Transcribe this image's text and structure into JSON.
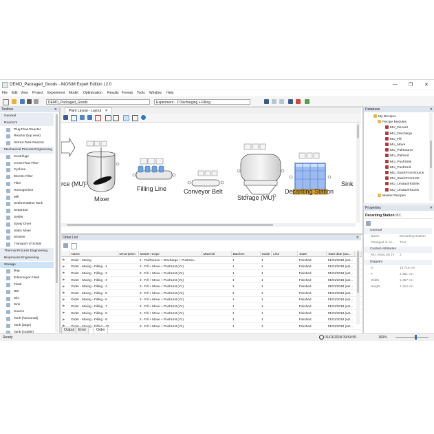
{
  "window": {
    "title": "DEMO_Packaged_Goods - INOSIM Expert Edition 12.0",
    "controls": [
      "—",
      "❐",
      "✕"
    ]
  },
  "menu": [
    "File",
    "Edit",
    "View",
    "Project",
    "Experiment",
    "Model",
    "Optimization",
    "Results",
    "Format",
    "Tools",
    "Window",
    "Help"
  ],
  "toolbar": {
    "project_combo": "DEMO_Packaged_Goods",
    "experiment_combo": "Experiment - 2 Discharging + Filling"
  },
  "toolbox": {
    "title": "Toolbox",
    "items": [
      {
        "label": "General",
        "type": "cat"
      },
      {
        "label": "Reactors",
        "type": "cat"
      },
      {
        "label": "Plug Flow Reactor",
        "type": "item"
      },
      {
        "label": "Reactor (top view)",
        "type": "item"
      },
      {
        "label": "Stirred-Tank Reactor",
        "type": "item"
      },
      {
        "label": "Mechanical Process Engineering",
        "type": "cat"
      },
      {
        "label": "Centrifuge",
        "type": "item"
      },
      {
        "label": "Cross Flow Filter",
        "type": "item"
      },
      {
        "label": "Cyclone",
        "type": "item"
      },
      {
        "label": "Electric Filter",
        "type": "item"
      },
      {
        "label": "Filter",
        "type": "item"
      },
      {
        "label": "Homogenizer",
        "type": "item"
      },
      {
        "label": "Mill",
        "type": "item"
      },
      {
        "label": "Sedimentation Tank",
        "type": "item"
      },
      {
        "label": "Separator",
        "type": "item"
      },
      {
        "label": "Settler",
        "type": "item"
      },
      {
        "label": "Spray Dryer",
        "type": "item"
      },
      {
        "label": "Static Mixer",
        "type": "item"
      },
      {
        "label": "Strainer",
        "type": "item"
      },
      {
        "label": "Transport of Solids",
        "type": "item"
      },
      {
        "label": "Thermal Process Engineering",
        "type": "cat"
      },
      {
        "label": "Bioprocess Engineering",
        "type": "cat"
      },
      {
        "label": "Storage",
        "type": "cat",
        "selected": true
      },
      {
        "label": "Bag",
        "type": "item"
      },
      {
        "label": "Erlenmeyer Flask",
        "type": "item"
      },
      {
        "label": "Flask",
        "type": "item"
      },
      {
        "label": "IBC",
        "type": "item"
      },
      {
        "label": "Silo",
        "type": "item"
      },
      {
        "label": "Sink",
        "type": "item"
      },
      {
        "label": "Source",
        "type": "item"
      },
      {
        "label": "Tank (horizontal)",
        "type": "item"
      },
      {
        "label": "Tank (large)",
        "type": "item"
      },
      {
        "label": "Tank (mobile)",
        "type": "item"
      }
    ]
  },
  "layout": {
    "tab_label": "Plant Layout - Layout",
    "equipment": [
      {
        "label": "rce (MU)"
      },
      {
        "label": "Mixer"
      },
      {
        "label": "Filling Line"
      },
      {
        "label": "Conveyor Belt"
      },
      {
        "label": "Storage (MU)"
      },
      {
        "label": "Decanting Station"
      },
      {
        "label": "Sink"
      }
    ]
  },
  "orderlist": {
    "title": "Order List",
    "columns": [
      "Name",
      "Description",
      "Master recipe",
      "Material",
      "Batches",
      "Scale",
      "Line",
      "State",
      "Start date (act...",
      "En"
    ],
    "rows": [
      [
        "Order - Mixing",
        "",
        "1 - PullSource + Discharge + PushSin...",
        "",
        "1",
        "1",
        "",
        "Finished",
        "01/01/2018 (act...",
        ""
      ],
      [
        "Order - Mixing - Filling - 1",
        "",
        "2 - Fill + Move + PushUnit (V1)",
        "",
        "1",
        "1",
        "",
        "Finished",
        "01/01/2018 (act...",
        ""
      ],
      [
        "Order - Mixing - Filling - 2",
        "",
        "2 - Fill + Move + PushUnit (V1)",
        "",
        "1",
        "1",
        "",
        "Finished",
        "01/01/2018 (act...",
        ""
      ],
      [
        "Order - Mixing - Filling - 3",
        "",
        "2 - Fill + Move + PushUnit (V1)",
        "",
        "1",
        "1",
        "",
        "Finished",
        "01/01/2018 (act...",
        ""
      ],
      [
        "Order - Mixing - Filling - 4",
        "",
        "2 - Fill + Move + PushUnit (V1)",
        "",
        "1",
        "1",
        "",
        "Finished",
        "01/01/2018 (act...",
        ""
      ],
      [
        "Order - Mixing - Filling - 5",
        "",
        "2 - Fill + Move + PushUnit (V1)",
        "",
        "1",
        "1",
        "",
        "Finished",
        "01/01/2018 (act...",
        ""
      ],
      [
        "Order - Mixing - Filling - 6",
        "",
        "2 - Fill + Move + PushUnit (V1)",
        "",
        "1",
        "1",
        "",
        "Finished",
        "01/01/2018 (act...",
        ""
      ],
      [
        "Order - Mixing - Filling - 7",
        "",
        "2 - Fill + Move + PushUnit (V1)",
        "",
        "1",
        "1",
        "",
        "Finished",
        "01/01/2018 (act...",
        ""
      ],
      [
        "Order - Mixing - Filling - 8",
        "",
        "2 - Fill + Move + PushUnit (V1)",
        "",
        "1",
        "1",
        "",
        "Finished",
        "01/01/2018 (act...",
        ""
      ],
      [
        "Order - Mixing - Filling - 9",
        "",
        "2 - Fill + Move + PushUnit (V1)",
        "",
        "1",
        "1",
        "",
        "Finished",
        "01/01/2018 (act...",
        ""
      ],
      [
        "Order - Mixing - Filling - 10",
        "",
        "2 - Fill + Move + PushUnit (V1)",
        "",
        "1",
        "1",
        "",
        "Finished",
        "01/01/2018 (act...",
        ""
      ]
    ],
    "bottom_tabs": [
      "Output",
      "Error List",
      "Order List"
    ]
  },
  "database": {
    "title": "Database",
    "items": [
      {
        "label": "My Recipes",
        "level": 1,
        "kind": "folder"
      },
      {
        "label": "Recipe Modules",
        "level": 2,
        "kind": "folder"
      },
      {
        "label": "MU_Decant",
        "level": 3,
        "kind": "recipe"
      },
      {
        "label": "MU_Discharge",
        "level": 3,
        "kind": "recipe"
      },
      {
        "label": "MU_Fill",
        "level": 3,
        "kind": "recipe"
      },
      {
        "label": "MU_Move",
        "level": 3,
        "kind": "recipe"
      },
      {
        "label": "MU_PullSource",
        "level": 3,
        "kind": "recipe"
      },
      {
        "label": "MU_PullUnit",
        "level": 3,
        "kind": "recipe"
      },
      {
        "label": "MU_PushSink",
        "level": 3,
        "kind": "recipe"
      },
      {
        "label": "MU_PushUnit",
        "level": 3,
        "kind": "recipe"
      },
      {
        "label": "MU_StackFromSource",
        "level": 3,
        "kind": "recipe"
      },
      {
        "label": "MU_StackFromUnit",
        "level": 3,
        "kind": "recipe"
      },
      {
        "label": "MU_UnstackToSink",
        "level": 3,
        "kind": "recipe"
      },
      {
        "label": "MU_UnstackToUnit",
        "level": 3,
        "kind": "recipe"
      },
      {
        "label": "Master Recipes",
        "level": 2,
        "kind": "folder"
      }
    ]
  },
  "properties": {
    "title": "Properties",
    "object_name": "Decanting Station",
    "object_type": "IBC",
    "rows": [
      {
        "type": "cat",
        "key": "General"
      },
      {
        "type": "row",
        "key": "Name",
        "value": "Decanting Station"
      },
      {
        "type": "row",
        "key": "Changed in cu...",
        "value": "True"
      },
      {
        "type": "cat",
        "key": "Custom Attributes"
      },
      {
        "type": "row",
        "key": "MU_MaxLots [-]",
        "value": "2"
      },
      {
        "type": "cat",
        "key": "Diagram"
      },
      {
        "type": "row",
        "key": "X",
        "value": "13.716 cm"
      },
      {
        "type": "row",
        "key": "Y",
        "value": "1.461 cm"
      },
      {
        "type": "row",
        "key": "Width",
        "value": "1.397 cm"
      },
      {
        "type": "row",
        "key": "Height",
        "value": "1.312 cm"
      }
    ]
  },
  "status": {
    "ready": "Ready",
    "datetime": "01/01/2018 09:54:59",
    "zoom": "160%"
  },
  "colors": {
    "panel_header": "#dfe5ee",
    "selection": "#cde3f8",
    "recipe_icon": "#b23a3a",
    "folder_icon": "#e8b84a"
  }
}
